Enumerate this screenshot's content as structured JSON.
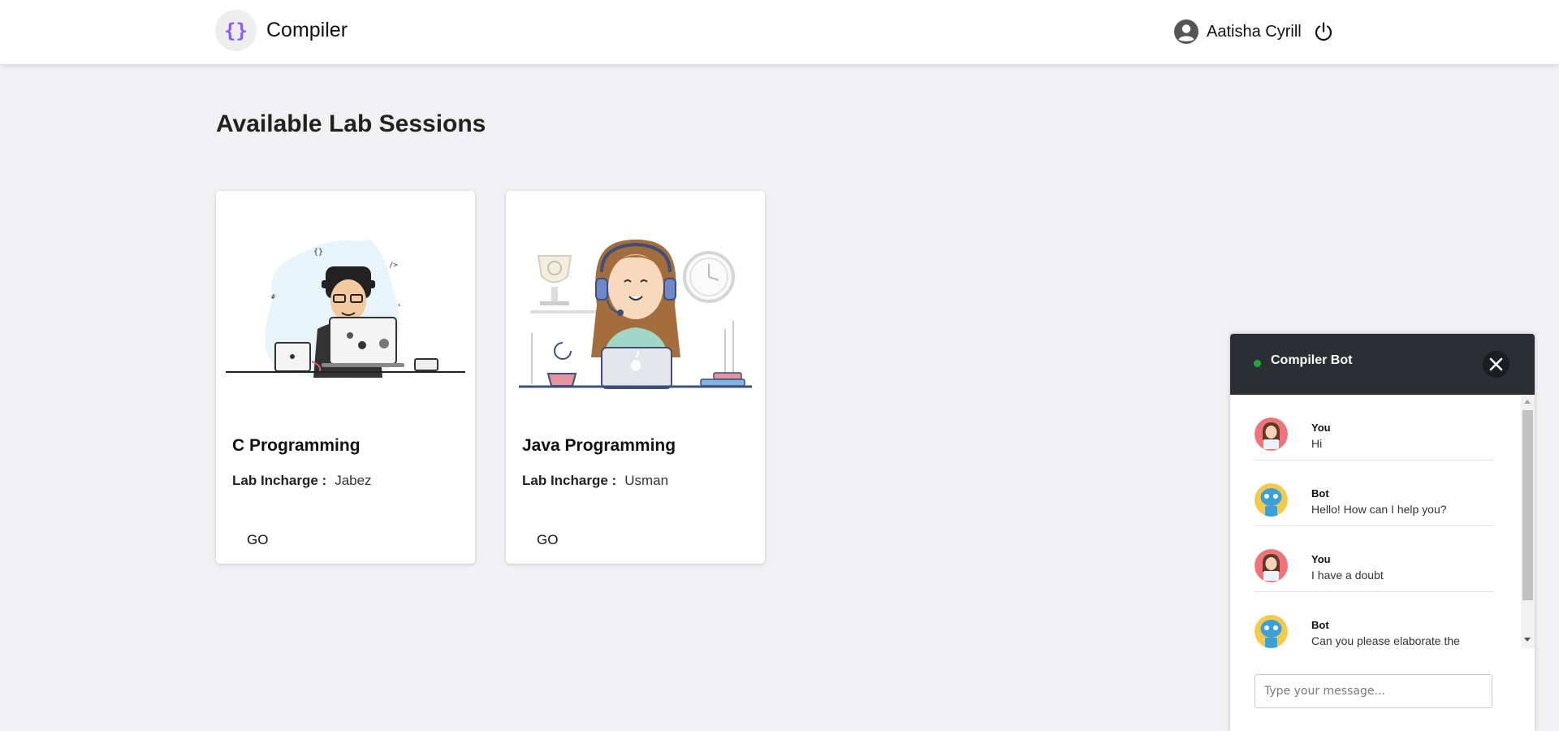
{
  "header": {
    "logo_text": "{}",
    "app_name": "Compiler",
    "user_name": "Aatisha Cyrill",
    "icons": [
      "braces-logo-icon",
      "user-circle-icon",
      "power-icon"
    ]
  },
  "main": {
    "title": "Available Lab Sessions",
    "cards": [
      {
        "title": "C Programming",
        "incharge_label": "Lab Incharge :",
        "incharge_name": "Jabez",
        "button": "GO",
        "illustration": "developer-laptop-illustration"
      },
      {
        "title": "Java Programming",
        "incharge_label": "Lab Incharge :",
        "incharge_name": "Usman",
        "button": "GO",
        "illustration": "developer-headset-illustration"
      }
    ]
  },
  "chat": {
    "title": "Compiler Bot",
    "status_color": "#22a83a",
    "messages": [
      {
        "sender": "You",
        "text": "Hi"
      },
      {
        "sender": "Bot",
        "text": "Hello! How can I help you?"
      },
      {
        "sender": "You",
        "text": "I have a doubt"
      },
      {
        "sender": "Bot",
        "text": "Can you please elaborate the"
      }
    ],
    "input_placeholder": "Type your message..."
  },
  "colors": {
    "page_bg": "#f1f1f3",
    "header_bg": "#ffffff",
    "accent_purple": "#8b5cf6",
    "chat_header_bg": "#2b2f33"
  }
}
